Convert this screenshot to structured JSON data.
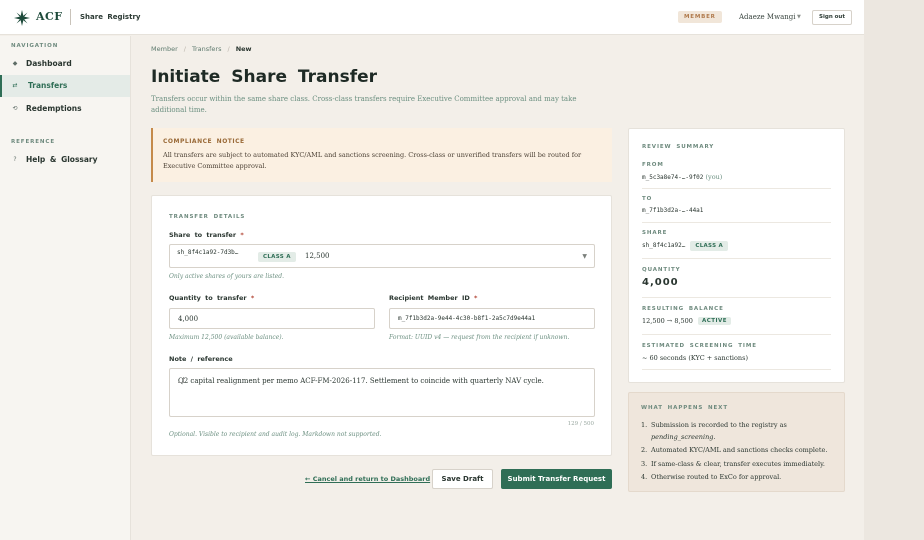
{
  "header": {
    "logo_text": "ACF",
    "app_name": "Share Registry",
    "role_badge": "MEMBER",
    "user_name": "Adaeze Mwangi",
    "signout_label": "Sign out"
  },
  "sidebar": {
    "nav_heading": "NAVIGATION",
    "nav_items": [
      {
        "icon": "◆",
        "label": "Dashboard"
      },
      {
        "icon": "⇄",
        "label": "Transfers"
      },
      {
        "icon": "⟲",
        "label": "Redemptions"
      }
    ],
    "ref_heading": "REFERENCE",
    "ref_items": [
      {
        "icon": "?",
        "label": "Help & Glossary"
      }
    ]
  },
  "breadcrumb": [
    "Member",
    "Transfers",
    "New"
  ],
  "page": {
    "title": "Initiate Share Transfer",
    "subtitle": "Transfers occur within the same share class. Cross-class transfers require Executive Committee approval and may take additional time."
  },
  "notice": {
    "title": "COMPLIANCE NOTICE",
    "body": "All transfers are subject to automated KYC/AML and sanctions screening. Cross-class or unverified transfers will be routed for Executive Committee approval."
  },
  "form": {
    "heading": "TRANSFER DETAILS",
    "share_label": "Share to transfer",
    "share_id": "sh_8f4c1a92-7d3b…",
    "share_class": "CLASS A",
    "share_amount": "12,500",
    "share_hint": "Only active shares of yours are listed.",
    "quantity_label": "Quantity to transfer",
    "quantity_value": "4,000",
    "quantity_hint": "Maximum 12,500 (available balance).",
    "recipient_label": "Recipient Member ID",
    "recipient_value": "m_7f1b3d2a-9e44-4c30-b8f1-2a5c7d9e44a1",
    "recipient_hint": "Format: UUID v4 — request from the recipient if unknown.",
    "note_label": "Note / reference",
    "note_value": "Q2 capital realignment per memo ACF-FM-2026-117. Settlement to coincide with quarterly NAV cycle.",
    "note_counter": "129 / 500",
    "note_hint": "Optional. Visible to recipient and audit log. Markdown not supported.",
    "required_mark": "*"
  },
  "actions": {
    "cancel_label": "← Cancel and return to Dashboard",
    "draft_label": "Save Draft",
    "submit_label": "Submit Transfer Request"
  },
  "summary": {
    "heading": "REVIEW SUMMARY",
    "from_key": "FROM",
    "from_val": "m_5c3a8e74-…-9f02",
    "from_you": "(you)",
    "to_key": "TO",
    "to_val": "m_7f1b3d2a-…-44a1",
    "share_key": "SHARE",
    "share_val": "sh_8f4c1a92…",
    "share_class": "CLASS A",
    "qty_key": "QUANTITY",
    "qty_val": "4,000",
    "balance_key": "RESULTING BALANCE",
    "balance_val": "12,500 → 8,500",
    "balance_status": "ACTIVE",
    "time_key": "ESTIMATED SCREENING TIME",
    "time_val": "~ 60 seconds (KYC + sanctions)"
  },
  "next": {
    "heading": "WHAT HAPPENS NEXT",
    "step1": "Submission is recorded to the registry as",
    "step1_em": "pending_screening",
    "step2": "Automated KYC/AML and sanctions checks complete.",
    "step3": "If same-class & clear, transfer executes immediately.",
    "step4": "Otherwise routed to ExCo for approval."
  },
  "colors": {
    "accent": "#2f6e56",
    "warning": "#c58a4a",
    "background": "#f3efe9"
  }
}
